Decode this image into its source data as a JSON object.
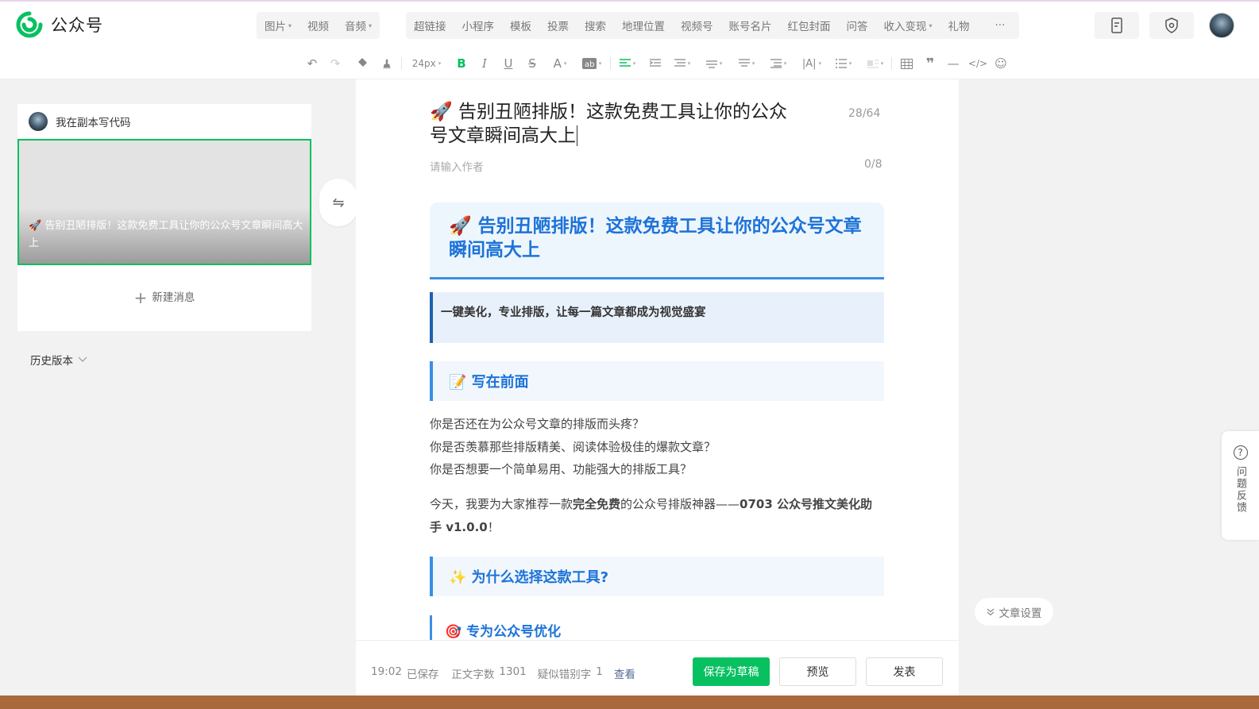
{
  "app": {
    "name": "公众号"
  },
  "menu": {
    "group1": [
      {
        "label": "图片",
        "caret": true
      },
      {
        "label": "视频",
        "caret": false
      },
      {
        "label": "音频",
        "caret": true
      }
    ],
    "group2": [
      {
        "label": "超链接",
        "caret": false
      },
      {
        "label": "小程序",
        "caret": false
      },
      {
        "label": "模板",
        "caret": false
      },
      {
        "label": "投票",
        "caret": false
      },
      {
        "label": "搜索",
        "caret": false
      },
      {
        "label": "地理位置",
        "caret": false
      },
      {
        "label": "视频号",
        "caret": false
      },
      {
        "label": "账号名片",
        "caret": false
      },
      {
        "label": "红包封面",
        "caret": false
      },
      {
        "label": "问答",
        "caret": false
      },
      {
        "label": "收入变现",
        "caret": true
      },
      {
        "label": "礼物",
        "caret": false
      }
    ],
    "more": "···"
  },
  "toolbar": {
    "font_size": "24px"
  },
  "sidebar": {
    "account_name": "我在副本写代码",
    "article_card_title": "🚀 告别丑陋排版！这款免费工具让你的公众号文章瞬间高大上",
    "new_message": "新建消息",
    "history": "历史版本"
  },
  "editor": {
    "title_line1": "🚀 告别丑陋排版！这款免费工具让你的公众",
    "title_line2": "号文章瞬间高大上",
    "title_count": "28/64",
    "author_placeholder": "请输入作者",
    "author_count": "0/8",
    "hero_title": "🚀 告别丑陋排版！这款免费工具让你的公众号文章瞬间高大上",
    "quote": "一键美化，专业排版，让每一篇文章都成为视觉盛宴",
    "section1": "📝 写在前面",
    "paragraph1": [
      "你是否还在为公众号文章的排版而头疼？",
      "你是否羡慕那些排版精美、阅读体验极佳的爆款文章？",
      "你是否想要一个简单易用、功能强大的排版工具？"
    ],
    "paragraph2_prefix": "今天，我要为大家推荐一款",
    "paragraph2_bold1": "完全免费",
    "paragraph2_mid": "的公众号排版神器——",
    "paragraph2_bold2": "0703 公众号推文美化助手 v1.0.0",
    "paragraph2_suffix": "！",
    "section2": "✨ 为什么选择这款工具?",
    "section3": "🎯 专为公众号优化"
  },
  "status": {
    "time": "19:02",
    "saved": "已保存",
    "word_count_label": "正文字数",
    "word_count": "1301",
    "typo_label": "疑似错别字",
    "typo_count": "1",
    "view": "查看"
  },
  "buttons": {
    "save_draft": "保存为草稿",
    "preview": "预览",
    "publish": "发表"
  },
  "feedback": "问题反馈",
  "article_settings": "文章设置",
  "colors": {
    "accent_green": "#07c160",
    "heading_blue": "#1d73d8",
    "border_blue": "#3a8ee6"
  }
}
